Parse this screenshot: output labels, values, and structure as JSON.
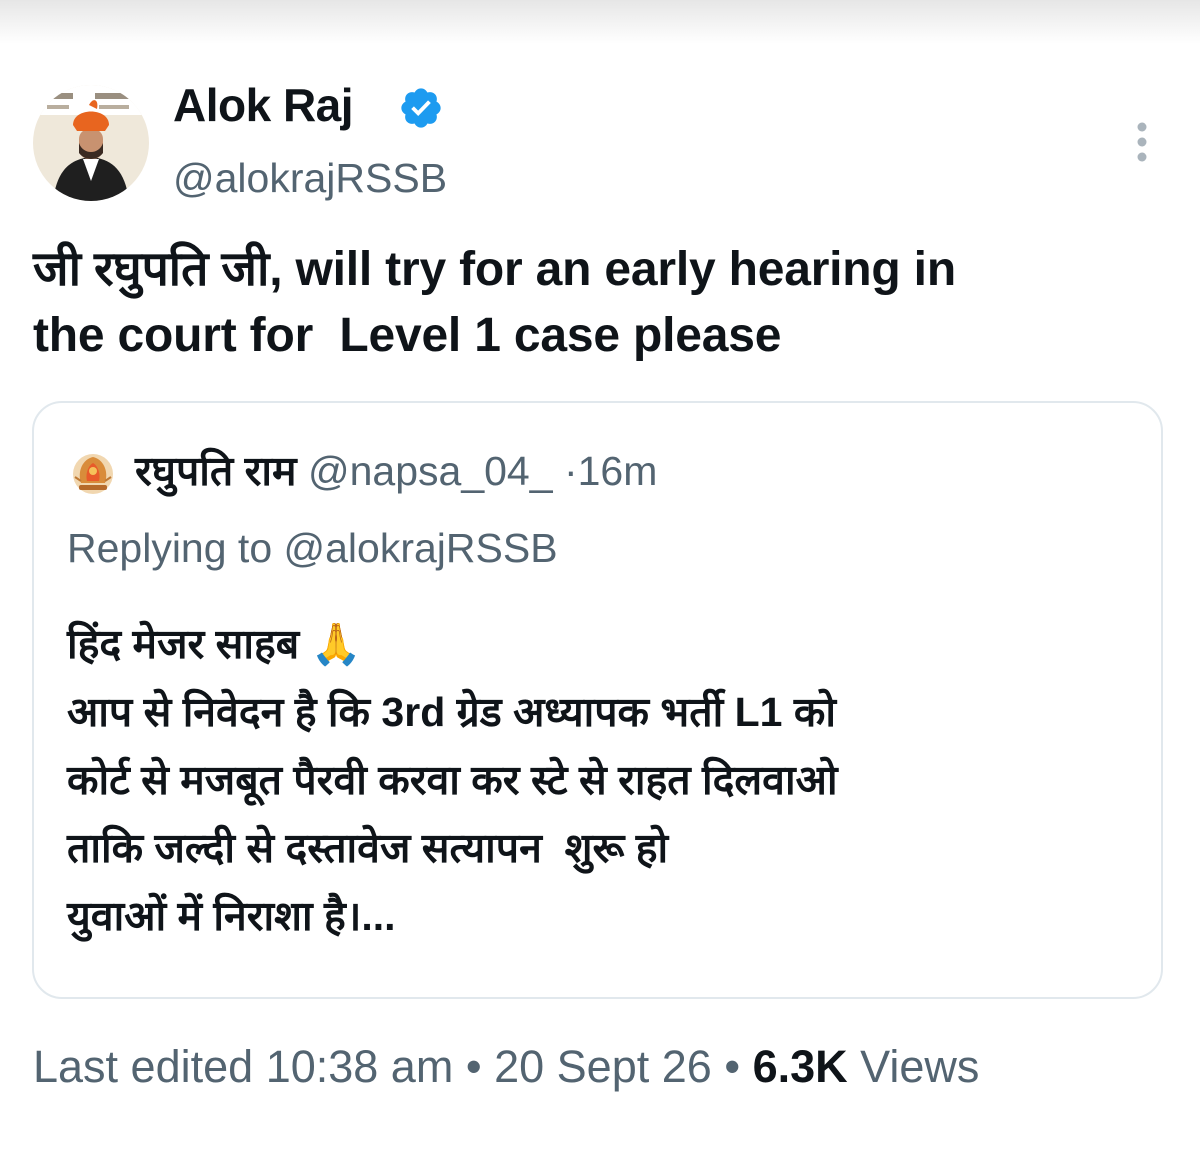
{
  "author": {
    "display_name": "Alok Raj",
    "handle": "@alokrajRSSB",
    "verified": true,
    "avatar": "avatar-photo"
  },
  "tweet": {
    "text": "जी रघुपति जी, will try for an early hearing in\nthe court for  Level 1 case please"
  },
  "quoted_tweet": {
    "display_name": "रघुपति राम",
    "handle": "@napsa_04_",
    "separator": "·",
    "time": "16m",
    "replying_to": "Replying to @alokrajRSSB",
    "text": "हिंद मेजर साहब 🙏\nआप से निवेदन है कि 3rd ग्रेड अध्यापक भर्ती L1 को\nकोर्ट से मजबूत पैरवी करवा कर स्टे से राहत दिलवाओ\nताकि जल्दी से दस्तावेज सत्यापन  शुरू हो\nयुवाओं में निराशा है।..."
  },
  "meta": {
    "edited_label": "Last edited",
    "time": "10:38 am",
    "separator": "•",
    "date": "20 Sept 26",
    "views_count": "6.3K",
    "views_label": "Views"
  },
  "icons": {
    "verified": "verified-badge-icon",
    "more": "more-vertical-icon",
    "quote_avatar": "emblem-avatar"
  },
  "colors": {
    "text": "#0f1419",
    "secondary": "#536471",
    "verified": "#1d9bf0",
    "border": "#e1e8ed"
  }
}
